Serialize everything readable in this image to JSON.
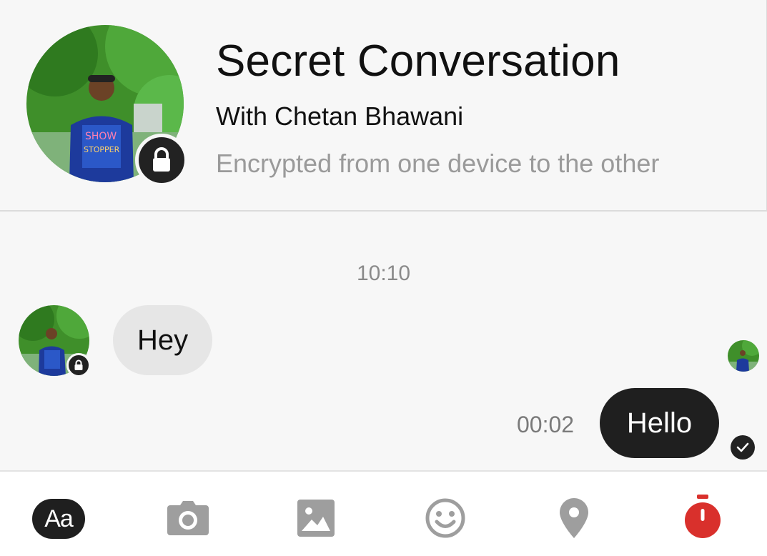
{
  "header": {
    "title": "Secret Conversation",
    "subtitle": "With Chetan Bhawani",
    "description": "Encrypted from one device to the other"
  },
  "messages": {
    "timestamp": "10:10",
    "incoming": {
      "text": "Hey"
    },
    "outgoing": {
      "text": "Hello",
      "time": "00:02"
    }
  },
  "toolbar": {
    "text_button_label": "Aa",
    "items": [
      "text-icon",
      "camera-icon",
      "gallery-icon",
      "emoji-icon",
      "location-icon",
      "timer-icon"
    ]
  },
  "colors": {
    "background": "#f7f7f7",
    "outgoing_bubble": "#1f1f1f",
    "incoming_bubble": "#e6e6e6",
    "icon_gray": "#9e9e9e",
    "timer_red": "#d9302c"
  }
}
